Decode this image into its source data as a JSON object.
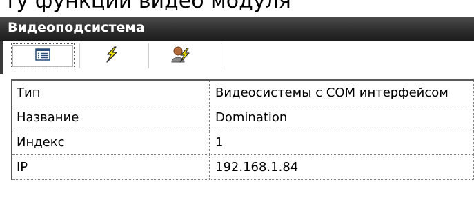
{
  "top_cutoff_text": "ту функции видео модуля",
  "panel": {
    "title": "Видеоподсистема"
  },
  "toolbar": {
    "buttons": [
      {
        "icon": "properties-list-icon",
        "active": true
      },
      {
        "icon": "lightning-icon",
        "active": false
      },
      {
        "icon": "user-lightning-icon",
        "active": false
      }
    ]
  },
  "properties": [
    {
      "key": "Тип",
      "value": "Видеосистемы с COM интерфейсом"
    },
    {
      "key": "Название",
      "value": "Domination"
    },
    {
      "key": "Индекс",
      "value": "1"
    },
    {
      "key": "IP",
      "value": "192.168.1.84"
    }
  ],
  "colors": {
    "header_bg": "#2e2e2e",
    "header_text": "#ffffff",
    "lightning": "#f2e600",
    "avatar": "#a0522d"
  }
}
